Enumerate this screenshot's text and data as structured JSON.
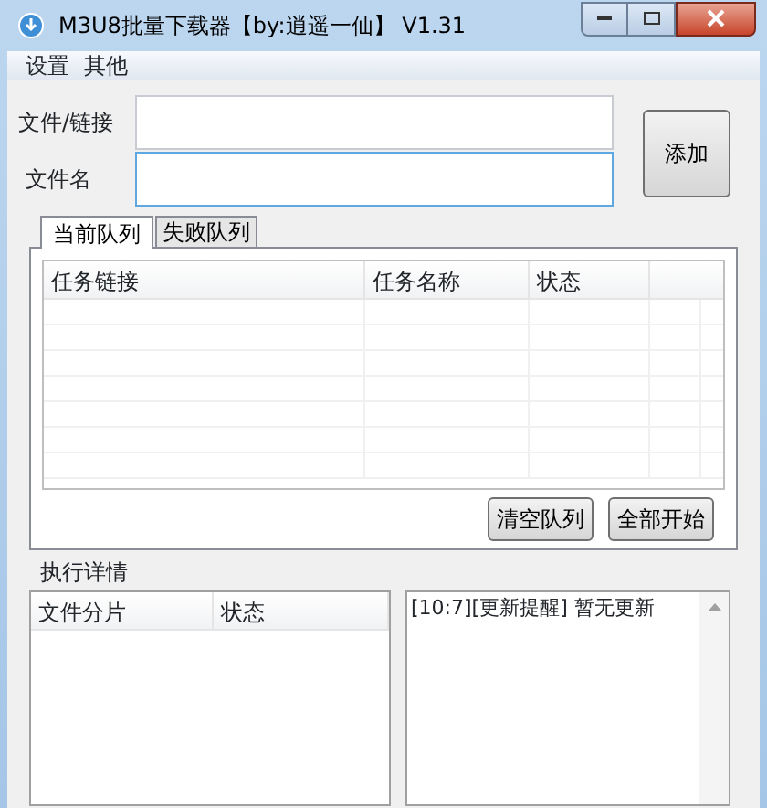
{
  "window": {
    "title": "M3U8批量下载器【by:逍遥一仙】 V1.31"
  },
  "menu": [
    {
      "label": "设置"
    },
    {
      "label": "其他"
    }
  ],
  "form": {
    "fields": [
      {
        "label": "文件/链接",
        "focused": false
      },
      {
        "label": "文件名",
        "focused": true
      }
    ],
    "add_button": "添加"
  },
  "tabs": [
    {
      "label": "当前队列",
      "selected": true
    },
    {
      "label": "失败队列",
      "selected": false
    }
  ],
  "queue_table": {
    "columns": [
      "任务链接",
      "任务名称",
      "状态"
    ]
  },
  "queue_buttons": [
    "清空队列",
    "全部开始"
  ],
  "details": {
    "title": "执行详情",
    "columns": [
      "文件分片",
      "状态"
    ],
    "log": "[10:7][更新提醒] 暂无更新"
  }
}
